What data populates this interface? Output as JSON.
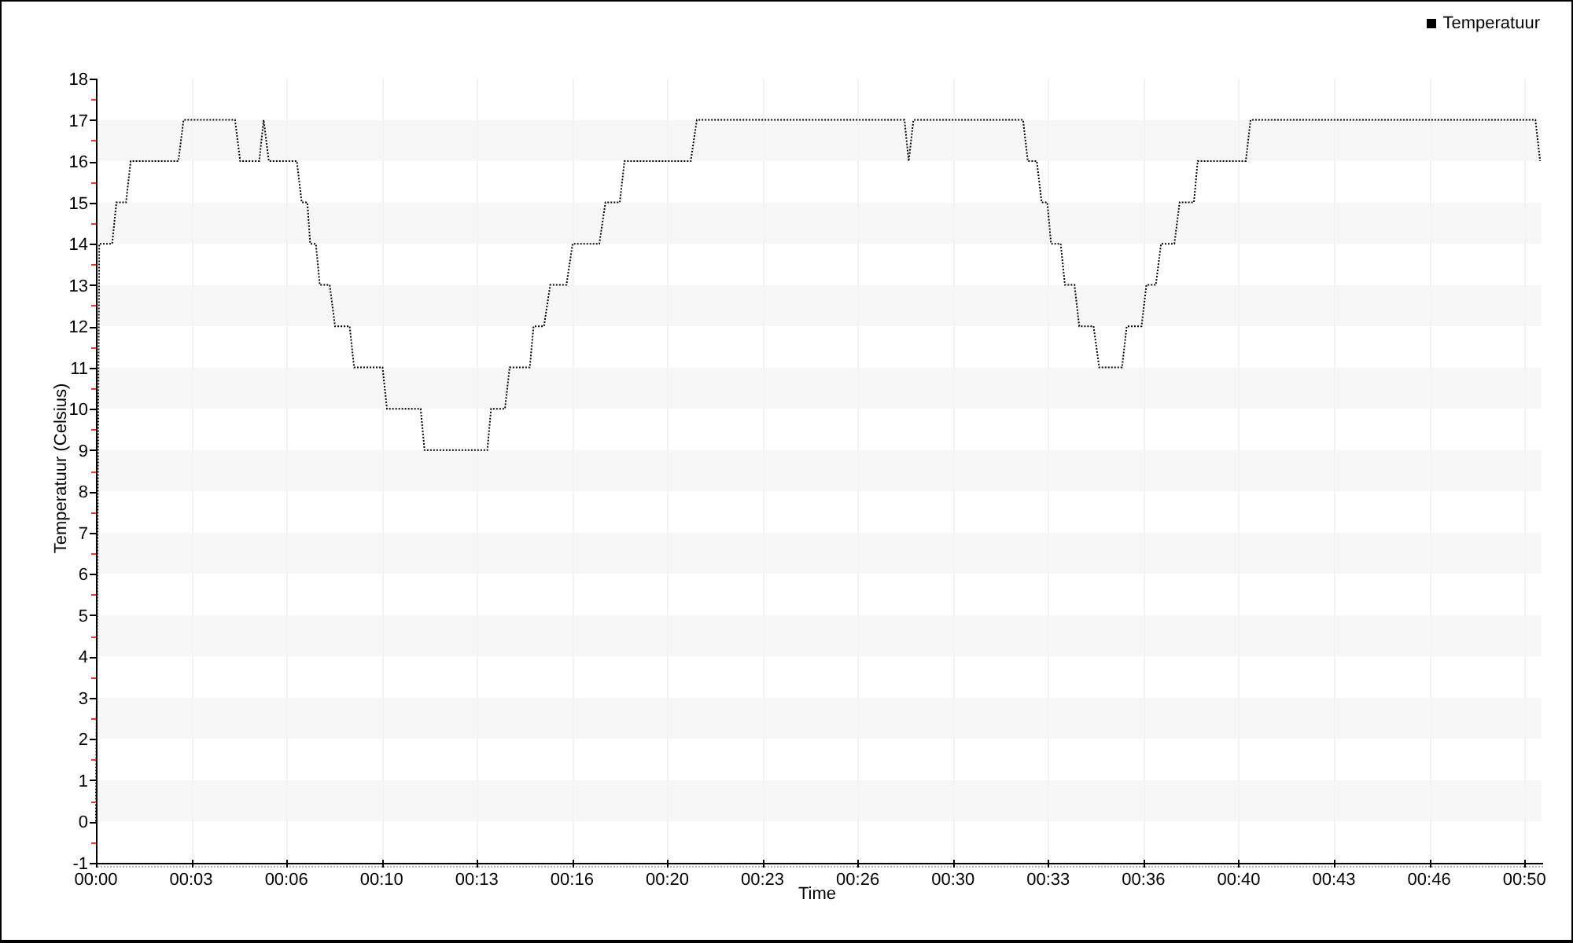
{
  "chart": {
    "chart_data": {
      "type": "line",
      "xlabel": "Time",
      "ylabel": "Temperatuur (Celsius)",
      "grid": true,
      "x": [
        -20,
        -13,
        14,
        23,
        43,
        53,
        153,
        164,
        272,
        283,
        323,
        332,
        343,
        402,
        412,
        424,
        430,
        442,
        450,
        471,
        482,
        513,
        522,
        582,
        591,
        662,
        670,
        802,
        810,
        839,
        849,
        891,
        899,
        921,
        934,
        968,
        981,
        1037,
        1050,
        1080,
        1090,
        1229,
        1242,
        1678,
        1687,
        1697,
        1927,
        1937,
        1956,
        1966,
        1978,
        1986,
        2006,
        2015,
        2035,
        2045,
        2075,
        2087,
        2135,
        2145,
        2176,
        2186,
        2206,
        2217,
        2245,
        2256,
        2286,
        2294,
        2395,
        2405,
        3003,
        3013
      ],
      "series": [
        {
          "name": "Temperatuur",
          "color": "#000000",
          "line_style": "dotted",
          "values": [
            0,
            14,
            14,
            15,
            15,
            16,
            16,
            17,
            17,
            16,
            16,
            17,
            16,
            16,
            15,
            15,
            14,
            14,
            13,
            13,
            12,
            12,
            11,
            11,
            10,
            10,
            9,
            9,
            10,
            10,
            11,
            11,
            12,
            12,
            13,
            13,
            14,
            14,
            15,
            15,
            16,
            16,
            17,
            17,
            16,
            17,
            17,
            16,
            16,
            15,
            15,
            14,
            14,
            13,
            13,
            12,
            12,
            11,
            11,
            12,
            12,
            13,
            13,
            14,
            14,
            15,
            15,
            16,
            16,
            17,
            17,
            16
          ]
        }
      ],
      "xlim": [
        -20,
        3016
      ],
      "ylim": [
        -1,
        18
      ],
      "xticks": [
        {
          "value": -20,
          "label": "00:00"
        },
        {
          "value": 180,
          "label": "00:03"
        },
        {
          "value": 380,
          "label": "00:06"
        },
        {
          "value": 580,
          "label": "00:10"
        },
        {
          "value": 780,
          "label": "00:13"
        },
        {
          "value": 980,
          "label": "00:16"
        },
        {
          "value": 1180,
          "label": "00:20"
        },
        {
          "value": 1380,
          "label": "00:23"
        },
        {
          "value": 1580,
          "label": "00:26"
        },
        {
          "value": 1780,
          "label": "00:30"
        },
        {
          "value": 1980,
          "label": "00:33"
        },
        {
          "value": 2180,
          "label": "00:36"
        },
        {
          "value": 2380,
          "label": "00:40"
        },
        {
          "value": 2580,
          "label": "00:43"
        },
        {
          "value": 2780,
          "label": "00:46"
        },
        {
          "value": 2980,
          "label": "00:50"
        }
      ],
      "yticks": [
        -1,
        0,
        1,
        2,
        3,
        4,
        5,
        6,
        7,
        8,
        9,
        10,
        11,
        12,
        13,
        14,
        15,
        16,
        17,
        18
      ]
    }
  }
}
